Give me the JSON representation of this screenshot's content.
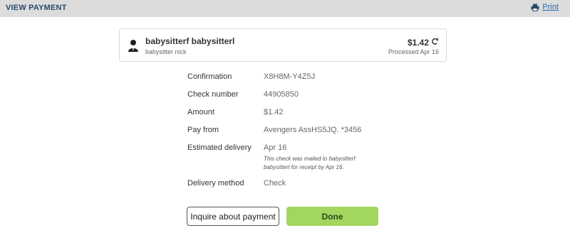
{
  "header": {
    "title": "VIEW PAYMENT",
    "print_label": "Print"
  },
  "payee": {
    "name": "babysitterf babysitterl",
    "nickname": "babysitter nick",
    "amount": "$1.42",
    "status": "Processed Apr 16"
  },
  "details": [
    {
      "label": "Confirmation",
      "value": "X8H8M-Y4Z5J"
    },
    {
      "label": "Check number",
      "value": "44905850"
    },
    {
      "label": "Amount",
      "value": "$1.42"
    },
    {
      "label": "Pay from",
      "value": "Avengers AssHS5JQ. *3456"
    },
    {
      "label": "Estimated delivery",
      "value": "Apr 16",
      "note": "This check was mailed to babysitterf babysitterl for receipt by Apr 16."
    },
    {
      "label": "Delivery method",
      "value": "Check"
    }
  ],
  "actions": {
    "inquire_label": "Inquire about payment",
    "done_label": "Done"
  },
  "colors": {
    "header_bg": "#dcdcdc",
    "title": "#2b4a6b",
    "link": "#1f6fb2",
    "done_bg": "#a3d65f"
  },
  "icons": {
    "print": "printer-icon",
    "avatar": "person-icon",
    "refresh": "refresh-icon"
  }
}
